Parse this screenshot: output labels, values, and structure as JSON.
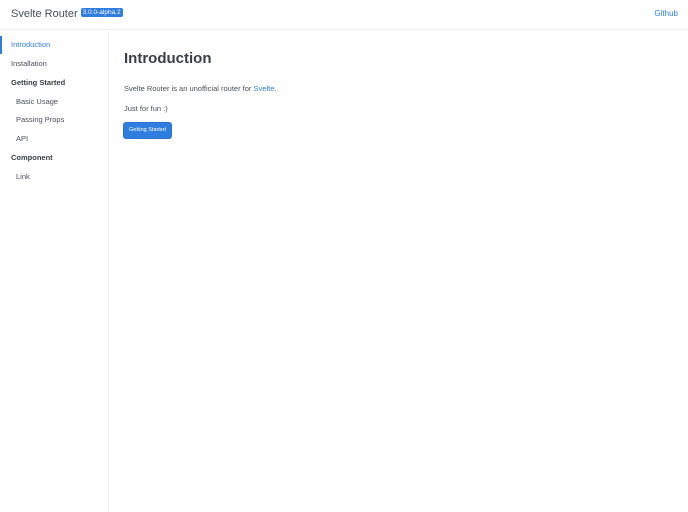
{
  "header": {
    "title": "Svelte Router",
    "version": "3.0.0-alpha.2",
    "github_link": "Github"
  },
  "sidebar": {
    "items": [
      {
        "label": "Introduction",
        "active": true
      },
      {
        "label": "Installation"
      }
    ],
    "sections": [
      {
        "heading": "Getting Started",
        "items": [
          {
            "label": "Basic Usage"
          },
          {
            "label": "Passing Props"
          },
          {
            "label": "API"
          }
        ]
      },
      {
        "heading": "Component",
        "items": [
          {
            "label": "Link"
          }
        ]
      }
    ]
  },
  "main": {
    "title": "Introduction",
    "intro_prefix": "Svelte Router is an unofficial router for ",
    "intro_link": "Svelte",
    "intro_suffix": ".",
    "note": "Just for fun :)",
    "button_label": "Getting Started"
  },
  "colors": {
    "accent": "#2f7ddf",
    "text": "#3a3f44"
  }
}
